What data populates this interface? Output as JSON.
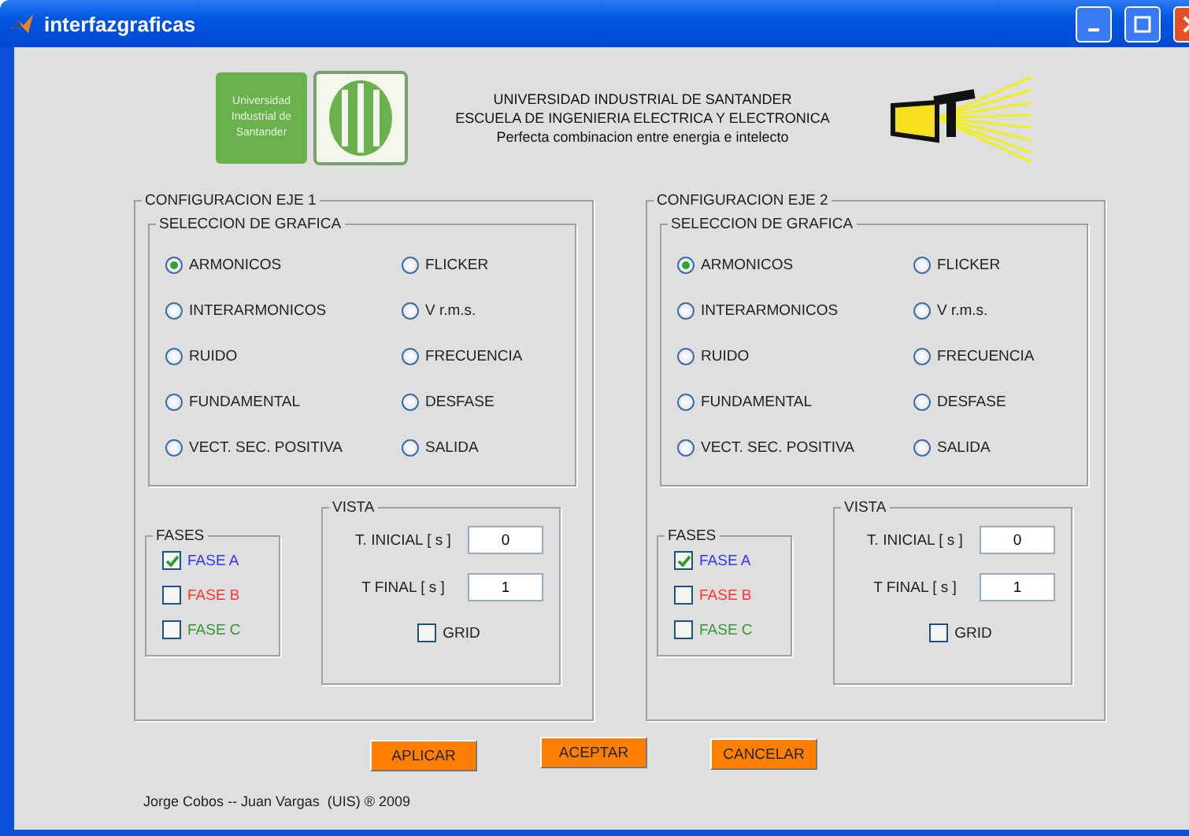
{
  "window": {
    "title": "interfazgraficas"
  },
  "header": {
    "logo_lines": [
      "Universidad",
      "Industrial de",
      "Santander"
    ],
    "lines": [
      "UNIVERSIDAD INDUSTRIAL DE SANTANDER",
      "ESCUELA DE INGENIERIA ELECTRICA Y ELECTRONICA",
      "Perfecta combinacion entre energia e intelecto"
    ]
  },
  "axes": [
    {
      "title": "CONFIGURACION EJE 1",
      "selection": {
        "title": "SELECCION DE GRAFICA",
        "options": [
          {
            "label": "ARMONICOS",
            "selected": true
          },
          {
            "label": "FLICKER",
            "selected": false
          },
          {
            "label": "INTERARMONICOS",
            "selected": false
          },
          {
            "label": "V r.m.s.",
            "selected": false
          },
          {
            "label": "RUIDO",
            "selected": false
          },
          {
            "label": "FRECUENCIA",
            "selected": false
          },
          {
            "label": "FUNDAMENTAL",
            "selected": false
          },
          {
            "label": "DESFASE",
            "selected": false
          },
          {
            "label": "VECT. SEC. POSITIVA",
            "selected": false
          },
          {
            "label": "SALIDA",
            "selected": false
          }
        ]
      },
      "phases": {
        "title": "FASES",
        "items": [
          {
            "label": "FASE A",
            "checked": true,
            "color": "#3333ff"
          },
          {
            "label": "FASE B",
            "checked": false,
            "color": "#ff3333"
          },
          {
            "label": "FASE C",
            "checked": false,
            "color": "#339933"
          }
        ]
      },
      "view": {
        "title": "VISTA",
        "fields": [
          {
            "label": "T. INICIAL [ s ]",
            "value": "0"
          },
          {
            "label": "T FINAL [ s ]",
            "value": "1"
          }
        ],
        "grid": {
          "label": "GRID",
          "checked": false
        }
      }
    },
    {
      "title": "CONFIGURACION EJE 2",
      "selection": {
        "title": "SELECCION DE GRAFICA",
        "options": [
          {
            "label": "ARMONICOS",
            "selected": true
          },
          {
            "label": "FLICKER",
            "selected": false
          },
          {
            "label": "INTERARMONICOS",
            "selected": false
          },
          {
            "label": "V r.m.s.",
            "selected": false
          },
          {
            "label": "RUIDO",
            "selected": false
          },
          {
            "label": "FRECUENCIA",
            "selected": false
          },
          {
            "label": "FUNDAMENTAL",
            "selected": false
          },
          {
            "label": "DESFASE",
            "selected": false
          },
          {
            "label": "VECT. SEC. POSITIVA",
            "selected": false
          },
          {
            "label": "SALIDA",
            "selected": false
          }
        ]
      },
      "phases": {
        "title": "FASES",
        "items": [
          {
            "label": "FASE A",
            "checked": true,
            "color": "#3333ff"
          },
          {
            "label": "FASE B",
            "checked": false,
            "color": "#ff3333"
          },
          {
            "label": "FASE C",
            "checked": false,
            "color": "#339933"
          }
        ]
      },
      "view": {
        "title": "VISTA",
        "fields": [
          {
            "label": "T. INICIAL [ s ]",
            "value": "0"
          },
          {
            "label": "T FINAL [ s ]",
            "value": "1"
          }
        ],
        "grid": {
          "label": "GRID",
          "checked": false
        }
      }
    }
  ],
  "buttons": [
    "APLICAR",
    "ACEPTAR",
    "CANCELAR"
  ],
  "footer": "Jorge Cobos -- Juan Vargas  (UIS) ® 2009"
}
